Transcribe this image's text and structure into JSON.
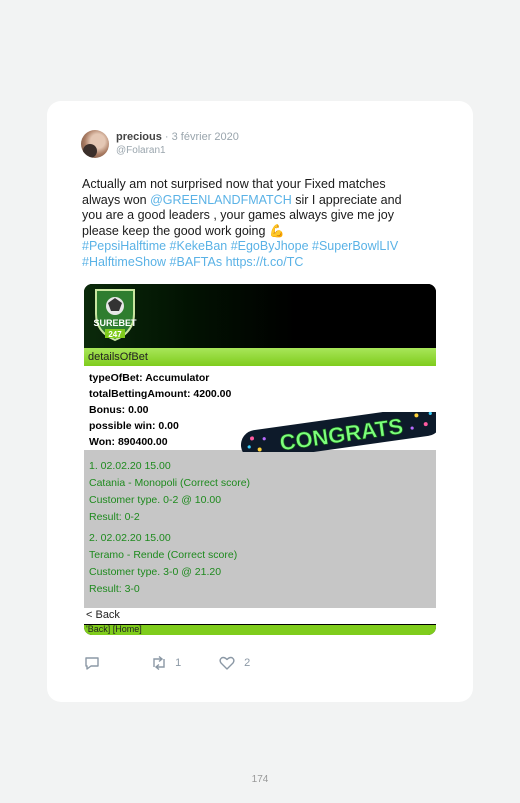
{
  "tweet": {
    "author_name": "precious",
    "date": " · 3 février 2020",
    "handle": "@Folaran1",
    "text_line1": "Actually am not surprised now that your Fixed matches",
    "text_line2_pre": "always won ",
    "mention": "@GREENLANDFMATCH",
    "text_line2_post": " sir I appreciate and",
    "text_line3": "you are a good leaders , your games always give me joy",
    "text_line4": "please keep the good work going 💪",
    "hashtags_line1": "#PepsiHalftime #KekeBan #EgoByJhope #SuperBowlLIV",
    "hashtags_line2": "#HalftimeShow #BAFTAs https://t.co/TC"
  },
  "screenshot": {
    "logo_top": "SUREBET",
    "logo_bottom": "247",
    "details_header": "detailsOfBet",
    "type_of_bet": "typeOfBet: Accumulator",
    "total_betting_amount": "totalBettingAmount:  4200.00",
    "bonus": "Bonus: 0.00",
    "possible_win": "possible win: 0.00",
    "won": "Won:  890400.00",
    "match1_date": "1.  02.02.20  15.00",
    "match1_teams": "Catania - Monopoli (Correct score)",
    "match1_customer": "Customer type. 0-2 @ 10.00",
    "match1_result": "Result: 0-2",
    "match2_date": "2.  02.02.20  15.00",
    "match2_teams": "Teramo - Rende (Correct score)",
    "match2_customer": "Customer type. 3-0 @ 21.20",
    "match2_result": "Result: 3-0",
    "back_label": "< Back",
    "footer_links": "'Back] [Home]",
    "congrats_text": "CONGRATS"
  },
  "actions": {
    "retweet_count": "1",
    "like_count": "2"
  },
  "page_number": "174"
}
